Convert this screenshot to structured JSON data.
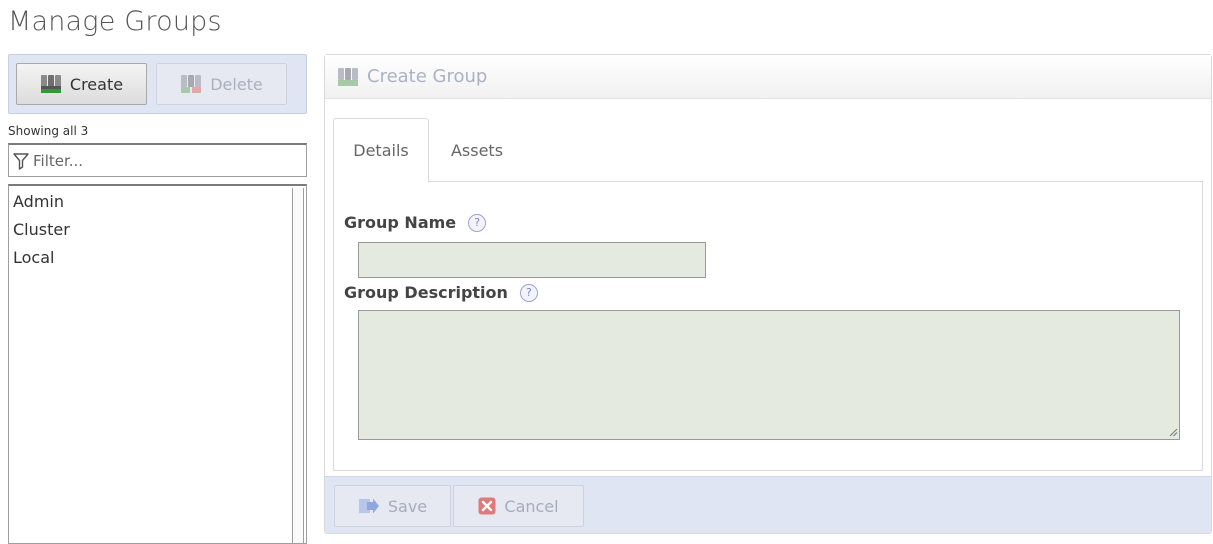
{
  "page": {
    "title": "Manage Groups"
  },
  "toolbar": {
    "create_label": "Create",
    "delete_label": "Delete"
  },
  "groups": {
    "showing_text": "Showing all 3",
    "filter_placeholder": "Filter...",
    "items": [
      "Admin",
      "Cluster",
      "Local"
    ]
  },
  "panel": {
    "title": "Create Group",
    "tabs": [
      {
        "label": "Details",
        "active": true
      },
      {
        "label": "Assets",
        "active": false
      }
    ],
    "fields": {
      "name_label": "Group Name",
      "name_value": "",
      "description_label": "Group Description",
      "description_value": "",
      "help_glyph": "?"
    },
    "save_label": "Save",
    "cancel_label": "Cancel"
  },
  "colors": {
    "toolbar_bg": "#dfe5f2",
    "input_bg": "#e4eadf",
    "disabled_text": "#aab0bd",
    "title_text": "#aab2c4",
    "cancel_icon": "#e07a7a",
    "save_icon": "#8fa6e0"
  },
  "icons": {
    "create": "group-add-icon",
    "delete": "group-remove-icon",
    "filter": "funnel-icon",
    "panel": "group-icon",
    "help": "question-icon",
    "save": "save-arrow-icon",
    "cancel": "cancel-x-icon"
  }
}
